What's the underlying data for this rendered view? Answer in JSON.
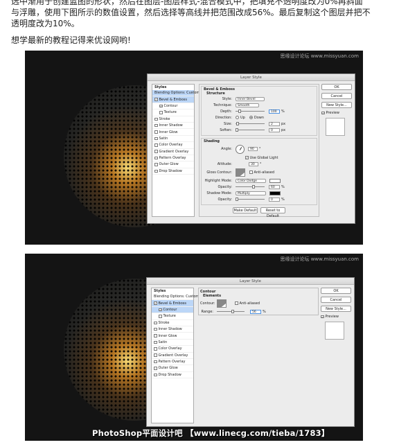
{
  "intro": {
    "line1": "选中渐用于创建蓝图的形状，然后在图层-图层样式-混合模式中，把填充不透明度改为0%再斜面",
    "line2": "与浮雕，使用下图所示的数值设置，然后选择等高线并把范围改成56%。最后复制这个图层并把不",
    "line3": "透明度改为10%。",
    "line4": "想学最新的教程记得来优设网哟!"
  },
  "watermark": "思缘设计论坛 www.missyuan.com",
  "shot1": {
    "dialog_title": "Layer Style",
    "styles_panel": {
      "header": "Styles",
      "items": [
        "Blending Options: Custom",
        "Bevel & Emboss",
        "Contour",
        "Texture",
        "Stroke",
        "Inner Shadow",
        "Inner Glow",
        "Satin",
        "Color Overlay",
        "Gradient Overlay",
        "Pattern Overlay",
        "Outer Glow",
        "Drop Shadow"
      ]
    },
    "buttons": {
      "ok": "OK",
      "cancel": "Cancel",
      "new_style": "New Style...",
      "preview": "Preview"
    },
    "bevel": {
      "group_title": "Bevel & Emboss",
      "structure_title": "Structure",
      "style_label": "Style:",
      "style_value": "Inner Bevel",
      "technique_label": "Technique:",
      "technique_value": "Smooth",
      "depth_label": "Depth:",
      "depth_value": "100",
      "depth_unit": "%",
      "direction_label": "Direction:",
      "direction_up": "Up",
      "direction_down": "Down",
      "size_label": "Size:",
      "size_value": "2",
      "size_unit": "px",
      "soften_label": "Soften:",
      "soften_value": "0",
      "soften_unit": "px"
    },
    "shading": {
      "title": "Shading",
      "angle_label": "Angle:",
      "angle_value": "90",
      "angle_unit": "°",
      "global_light": "Use Global Light",
      "altitude_label": "Altitude:",
      "altitude_value": "30",
      "altitude_unit": "°",
      "gloss_label": "Gloss Contour:",
      "anti_aliased": "Anti-aliased",
      "highlight_label": "Highlight Mode:",
      "highlight_value": "Color Dodge",
      "hl_opacity_label": "Opacity:",
      "hl_opacity_value": "60",
      "hl_opacity_unit": "%",
      "shadow_label": "Shadow Mode:",
      "shadow_value": "Multiply",
      "sh_opacity_label": "Opacity:",
      "sh_opacity_value": "0",
      "sh_opacity_unit": "%"
    },
    "bottom": {
      "make_default": "Make Default",
      "reset_default": "Reset to Default"
    }
  },
  "shot2": {
    "dialog_title": "Layer Style",
    "styles_panel": {
      "header": "Styles",
      "items": [
        "Blending Options: Custom",
        "Bevel & Emboss",
        "Contour",
        "Texture",
        "Stroke",
        "Inner Shadow",
        "Inner Glow",
        "Satin",
        "Color Overlay",
        "Gradient Overlay",
        "Pattern Overlay",
        "Outer Glow",
        "Drop Shadow"
      ]
    },
    "buttons": {
      "ok": "OK",
      "cancel": "Cancel",
      "new_style": "New Style...",
      "preview": "Preview"
    },
    "contour": {
      "title": "Contour",
      "elements_title": "Elements",
      "contour_label": "Contour:",
      "anti_aliased": "Anti-aliased",
      "range_label": "Range:",
      "range_value": "56",
      "range_unit": "%"
    }
  },
  "banner": "PhotoShop平面设计吧 【www.linecg.com/tieba/1783】"
}
